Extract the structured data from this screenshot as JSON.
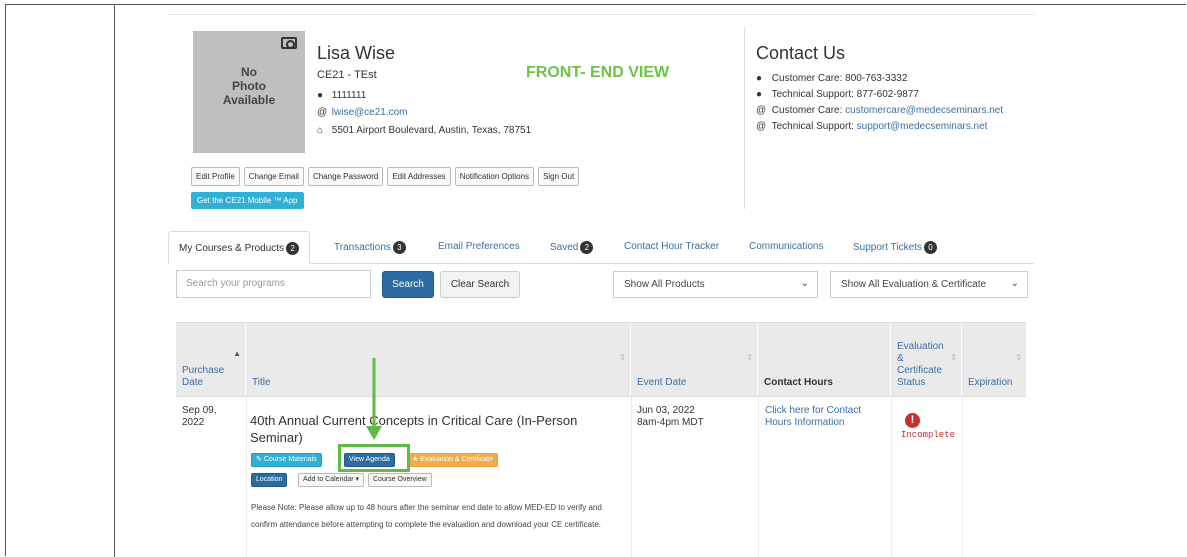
{
  "profile": {
    "photo_text": [
      "No",
      "Photo",
      "Available"
    ],
    "name": "Lisa Wise",
    "org": "CE21 - TEst",
    "banner": "FRONT- END VIEW",
    "id": "1111111",
    "email": "lwise@ce21.com",
    "address": "5501 Airport Boulevard, Austin, Texas, 78751",
    "buttons": [
      "Edit Profile",
      "Change Email",
      "Change Password",
      "Edit Addresses",
      "Notification Options",
      "Sign Out"
    ],
    "app_button": "Get the CE21 Mobile ™ App"
  },
  "contact": {
    "title": "Contact Us",
    "care_phone_label": "Customer Care: 800-763-3332",
    "support_phone_label": "Technical Support: 877-602-9877",
    "care_email_label": "Customer Care: ",
    "care_email": "customercare@medecseminars.net",
    "support_email_label": "Technical Support: ",
    "support_email": "support@medecseminars.net"
  },
  "tabs": [
    {
      "label": "My Courses & Products",
      "badge": "2"
    },
    {
      "label": "Transactions",
      "badge": "3"
    },
    {
      "label": "Email Preferences",
      "badge": ""
    },
    {
      "label": "Saved",
      "badge": "2"
    },
    {
      "label": "Contact Hour Tracker",
      "badge": ""
    },
    {
      "label": "Communications",
      "badge": ""
    },
    {
      "label": "Support Tickets",
      "badge": "0"
    }
  ],
  "filters": {
    "search_placeholder": "Search your programs",
    "search_button": "Search",
    "clear_button": "Clear Search",
    "products_select": "Show All Products",
    "eval_select": "Show All Evaluation & Certificate"
  },
  "table": {
    "headers": {
      "purchase_date": [
        "Purchase",
        "Date"
      ],
      "title": "Title",
      "event_date": "Event Date",
      "contact_hours": "Contact Hours",
      "eval_status": [
        "Evaluation",
        "&",
        "Certificate",
        "Status"
      ],
      "expiration": "Expiration"
    },
    "row": {
      "purchase_date": [
        "Sep 09,",
        "2022"
      ],
      "title": "40th Annual Current Concepts in Critical Care (In-Person Seminar)",
      "buttons": {
        "course_materials": "Course Materials",
        "view_agenda": "View Agenda",
        "evaluation": "★ Evaluation & Certificate",
        "location": "Location",
        "add_to_calendar": "Add to Calendar ▾",
        "course_overview": "Course Overview"
      },
      "note": "Please Note: Please allow up to 48 hours after the seminar end date to allow MED-ED to verify and confirm attendance before attempting to complete the evaluation and download your CE certificate.",
      "event_date": [
        "Jun 03, 2022",
        "8am-4pm MDT"
      ],
      "contact_hours_link": [
        "Click here for Contact",
        "Hours Information"
      ],
      "status": "Incomplete"
    }
  },
  "colors": {
    "accent_green": "#5dbb46",
    "link_blue": "#3a6ea5",
    "primary": "#2d6ca2"
  }
}
